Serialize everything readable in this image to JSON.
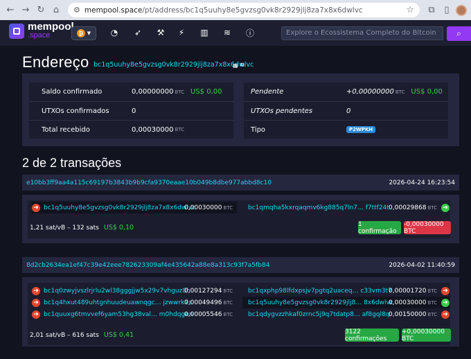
{
  "browser": {
    "url_host": "mempool.space",
    "url_path": "/pt/address/bc1q5uuhy8e5gvzsg0vk8r2929jlj8za7x8x6dwlvc"
  },
  "nav": {
    "logo_top": "mempool",
    "logo_bottom": ".space",
    "search_placeholder": "Explore o Ecossistema Completo do Bitcoin"
  },
  "page": {
    "title": "Endereço",
    "address": "bc1q5uuhy8e5gvzsg0vk8r2929jlj8za7x8x6dwlvc"
  },
  "summary": {
    "left": [
      {
        "label": "Saldo confirmado",
        "value": "0,00000000",
        "unit": "BTC",
        "fiat": "US$ 0,00"
      },
      {
        "label": "UTXOs confirmados",
        "value": "0",
        "unit": "",
        "fiat": ""
      },
      {
        "label": "Total recebido",
        "value": "0,00030000",
        "unit": "BTC",
        "fiat": ""
      }
    ],
    "right": [
      {
        "label": "Pendente",
        "value": "+0,00000000",
        "unit": "BTC",
        "fiat": "US$ 0,00"
      },
      {
        "label": "UTXOs pendentes",
        "value": "0",
        "unit": "",
        "fiat": ""
      },
      {
        "label": "Tipo",
        "value": "P2WPKH",
        "unit": "",
        "fiat": ""
      }
    ]
  },
  "tx_section_title": "2 de 2 transações",
  "transactions": [
    {
      "txid": "e10bb3ff9aa4a115c69197b3843b9b9cfa9370eaae10b049b8dbe977abbd8c10",
      "datetime": "2026-04-24 16:23:54",
      "inputs": [
        {
          "address": "bc1q5uuhy8e5gvzsg0vk8r2929jlj8za7x8x6dwlvc",
          "amount": "0,00030000",
          "unit": "BTC"
        }
      ],
      "outputs": [
        {
          "address": "bc1qmqha5kxrqaqmv6kg885q7ln7… f7ttf24t",
          "amount": "0,00029868",
          "unit": "BTC"
        }
      ],
      "fee_rate": "1,21 sat/vB – 132 sats",
      "fee_fiat": "US$ 0,10",
      "confirmations": "1 confirmação",
      "delta": "-0,00030000 BTC"
    },
    {
      "txid": "8d2cb2634ea1ef47c39e42eee782623309af4e435642a88e8a313c93f7a5fb84",
      "datetime": "2026-04-02 11:40:59",
      "inputs": [
        {
          "address": "bc1q0zwyjvszlrjrlu2wl38gggjjw5x29v7vhguz8h",
          "amount": "0,00127294",
          "unit": "BTC"
        },
        {
          "address": "bc1q4hxut489uhtgnhuudeuawnqgc… jzwwrk7s",
          "amount": "0,00049496",
          "unit": "BTC"
        },
        {
          "address": "bc1quuxg6tmvvef6yam53hg38val… m0hdqgen",
          "amount": "0,00005546",
          "unit": "BTC"
        }
      ],
      "outputs": [
        {
          "address": "bc1qxphp98lfdxpsjv7pgtq2uaceq… c33vm3t7",
          "amount": "0,00001720",
          "unit": "BTC"
        },
        {
          "address": "bc1q5uuhy8e5gvzsg0vk8r2929jlj8… 8x6dwlvc",
          "amount": "0,00030000",
          "unit": "BTC"
        },
        {
          "address": "bc1qdygvzzhkaf0zrnc5j9q7tdatp8… af8gql8q",
          "amount": "0,00150000",
          "unit": "BTC"
        }
      ],
      "fee_rate": "2,01 sat/vB – 616 sats",
      "fee_fiat": "US$ 0,41",
      "confirmations": "3122 confirmações",
      "delta": "+0,00030000 BTC"
    }
  ]
}
